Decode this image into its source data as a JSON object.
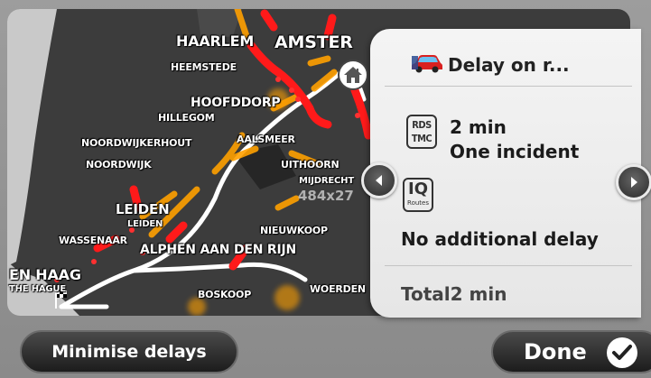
{
  "map": {
    "cities": {
      "haarlem": "HAARLEM",
      "amsterdam": "AMSTER",
      "heemstede": "HEEMSTEDE",
      "hoofddorp": "HOOFDDORP",
      "hillegom": "HILLEGOM",
      "noordwijkerhout": "NOORDWIJKERHOUT",
      "aalsmeer": "AALSMEER",
      "noordwijk": "NOORDWIJK",
      "uithoorn": "UITHOORN",
      "mijdrecht": "MIJDRECHT",
      "leiden": "LEIDEN",
      "leiden_small": "LEIDEN",
      "wassenaar": "WASSENAAR",
      "nieuwkoop": "NIEUWKOOP",
      "alphen": "ALPHEN AAN DEN RIJN",
      "den_haag": "EN HAAG",
      "den_haag_small": "THE HAGUE",
      "boskoop": "BOSKOOP",
      "woerden": "WOERDEN"
    },
    "watermark": "484x27",
    "home_icon": "home-icon",
    "flag_icon": "checkered-flag-icon"
  },
  "panel": {
    "title": "Delay on r...",
    "title_icon": "car-icon",
    "rds_icon": [
      "RDS",
      "TMC"
    ],
    "delay_time": "2 min",
    "incident_count": "One incident",
    "iq_icon": [
      "IQ",
      "Routes"
    ],
    "additional_delay": "No additional delay",
    "total": "Total2 min"
  },
  "nav": {
    "prev_icon": "arrow-left-icon",
    "next_icon": "arrow-right-icon"
  },
  "buttons": {
    "minimise": "Minimise delays",
    "done": "Done",
    "done_icon": "checkmark-icon"
  },
  "colors": {
    "map_land": "#3a3a3a",
    "sea": "#c8c8c8",
    "traffic_red": "#ff1a1a",
    "traffic_orange": "#ffa000",
    "route": "#ffffff",
    "button_dark": "#222222"
  }
}
